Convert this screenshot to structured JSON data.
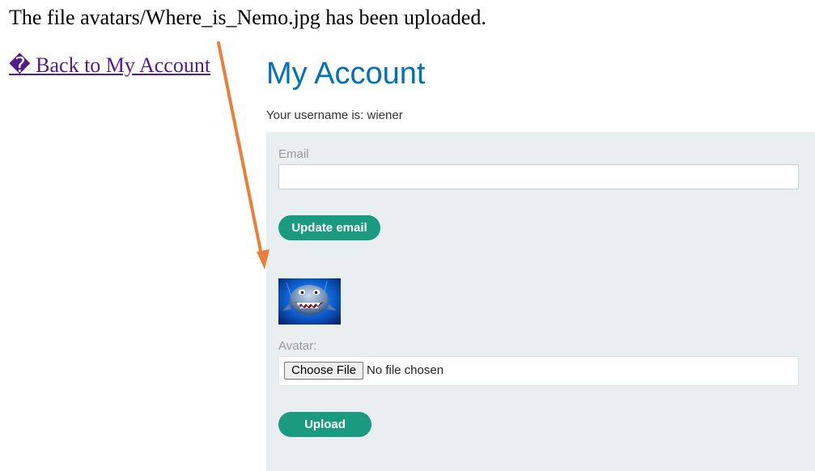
{
  "notification": {
    "message": "The file avatars/Where_is_Nemo.jpg has been uploaded."
  },
  "nav": {
    "back_link": "� Back to My Account"
  },
  "account": {
    "title": "My Account",
    "username_line": "Your username is: wiener",
    "email": {
      "label": "Email",
      "value": "",
      "placeholder": ""
    },
    "update_email_button": "Update email",
    "avatar": {
      "label": "Avatar:",
      "choose_file_button": "Choose File",
      "file_status": "No file chosen"
    },
    "upload_button": "Upload"
  },
  "colors": {
    "title_blue": "#0071bc",
    "button_green": "#1a9a7f",
    "panel_bg": "#e9eef0",
    "link_visited": "#551a8b",
    "annotation_arrow": "#ea7f3a"
  },
  "icons": {
    "avatar_image": "shark-avatar-image",
    "annotation": "orange-arrow-annotation"
  }
}
